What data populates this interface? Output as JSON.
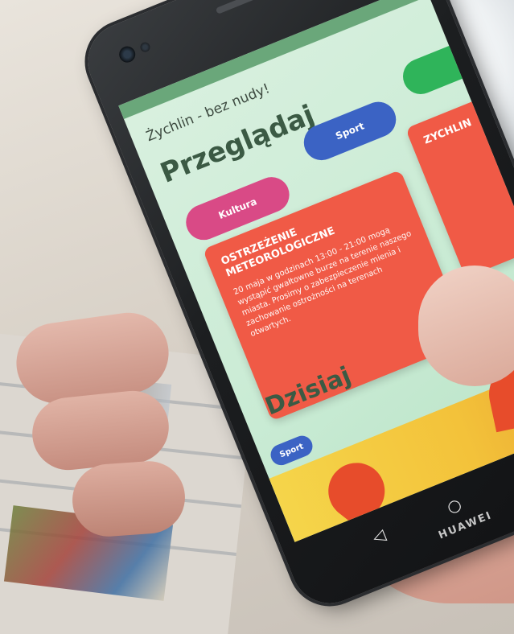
{
  "app": {
    "title": "Żychlin - bez nudy!",
    "browse_heading": "Przeglądaj",
    "today_heading": "Dzisiaj"
  },
  "categories": [
    {
      "label": "Kultura",
      "color": "#d94a86"
    },
    {
      "label": "Sport",
      "color": "#3b63c4"
    },
    {
      "label": "",
      "color": "#2fb45a"
    }
  ],
  "cards": [
    {
      "title": "OSTRZEŻENIE METEOROLOGICZNE",
      "body": "20 maja w godzinach 13:00 - 21:00 mogą wystąpić gwałtowne burze na terenie naszego miasta. Prosimy o zabezpieczenie mienia i zachowanie ostrożności na terenach otwartych.",
      "color": "#f05a46"
    },
    {
      "title": "ZYCHLIN",
      "body": "",
      "color": "#f05a46"
    }
  ],
  "today": {
    "badge": "Sport",
    "badge_color": "#3b63c4"
  },
  "device": {
    "brand": "HUAWEI",
    "nav_icons": [
      "back-icon",
      "home-icon",
      "recents-icon"
    ]
  },
  "colors": {
    "screen_bg": "#c9ebd4",
    "heading": "#3b5a44",
    "status_bar": "#6aa77a"
  }
}
